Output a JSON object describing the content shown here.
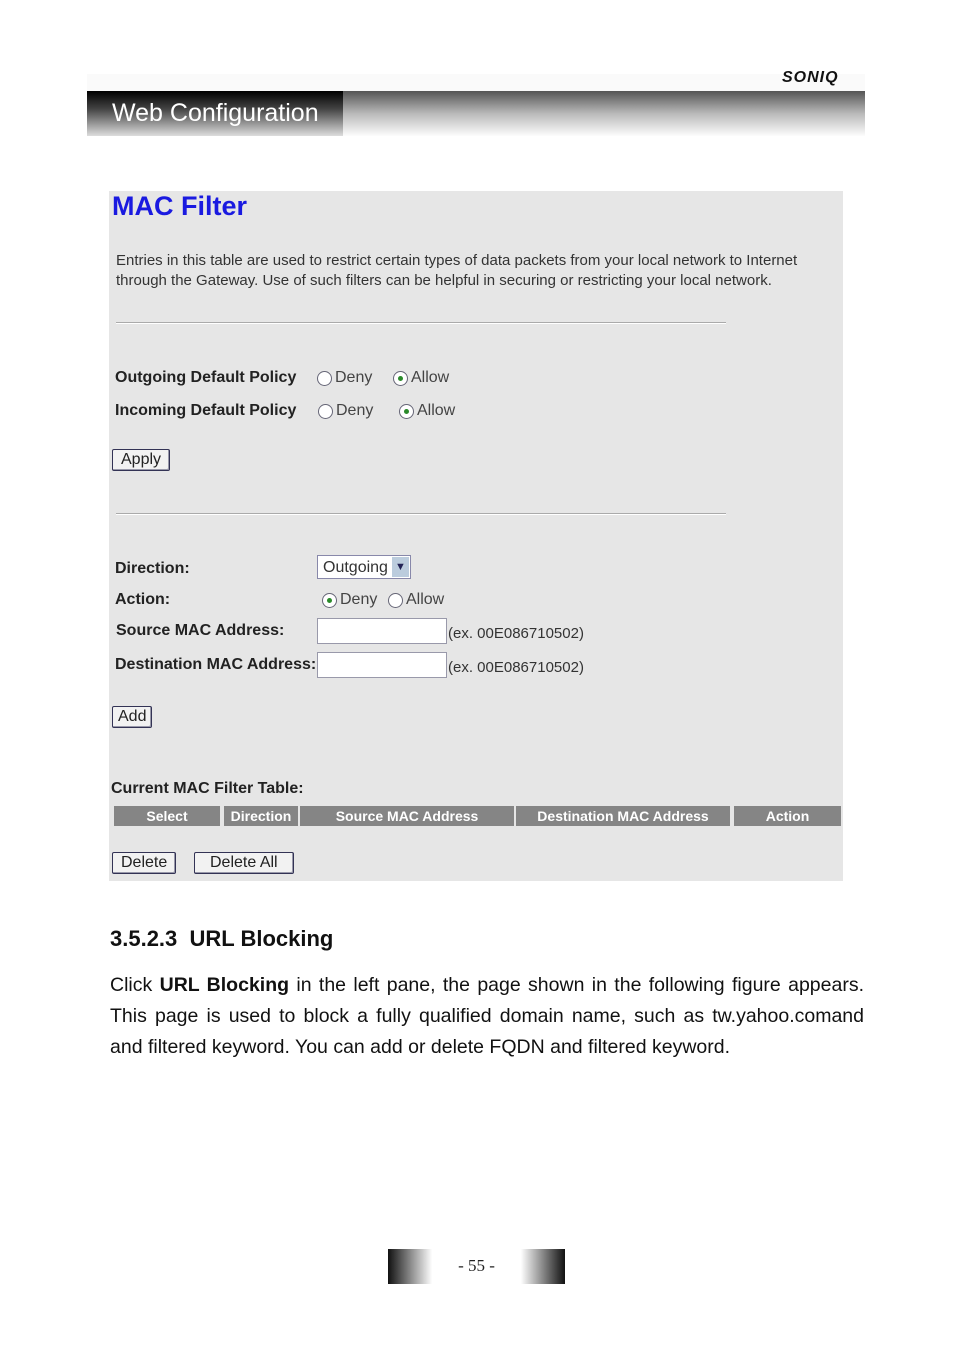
{
  "header": {
    "title": "Web Configuration",
    "logo": "SONIQ"
  },
  "screenshot": {
    "title": "MAC Filter",
    "description": "Entries in this table are used to restrict certain types of data packets from your local network to Internet through the Gateway. Use of such filters can be helpful in securing or restricting your local network.",
    "outgoing_label": "Outgoing Default Policy",
    "incoming_label": "Incoming Default Policy",
    "deny": "Deny",
    "allow": "Allow",
    "outgoing_value": "Allow",
    "incoming_value": "Allow",
    "apply": "Apply",
    "direction_label": "Direction:",
    "direction_value": "Outgoing",
    "action_label": "Action:",
    "action_value": "Deny",
    "source_label": "Source MAC Address:",
    "source_value": "",
    "source_hint": "(ex. 00E086710502)",
    "dest_label": "Destination MAC Address:",
    "dest_value": "",
    "dest_hint": "(ex. 00E086710502)",
    "add": "Add",
    "table_title": "Current MAC Filter Table:",
    "columns": [
      "Select",
      "Direction",
      "Source MAC Address",
      "Destination MAC Address",
      "Action"
    ],
    "delete": "Delete",
    "delete_all": "Delete All"
  },
  "section": {
    "number": "3.5.2.3",
    "title": "URL Blocking"
  },
  "body": {
    "pre": "Click ",
    "bold": "URL Blocking",
    "post": " in the left pane, the page shown in the following figure appears. This page is used to block a fully qualified domain name, such as tw.yahoo.comand and filtered keyword. You can add or delete FQDN and filtered keyword."
  },
  "footer": {
    "page": "- 55 -"
  }
}
